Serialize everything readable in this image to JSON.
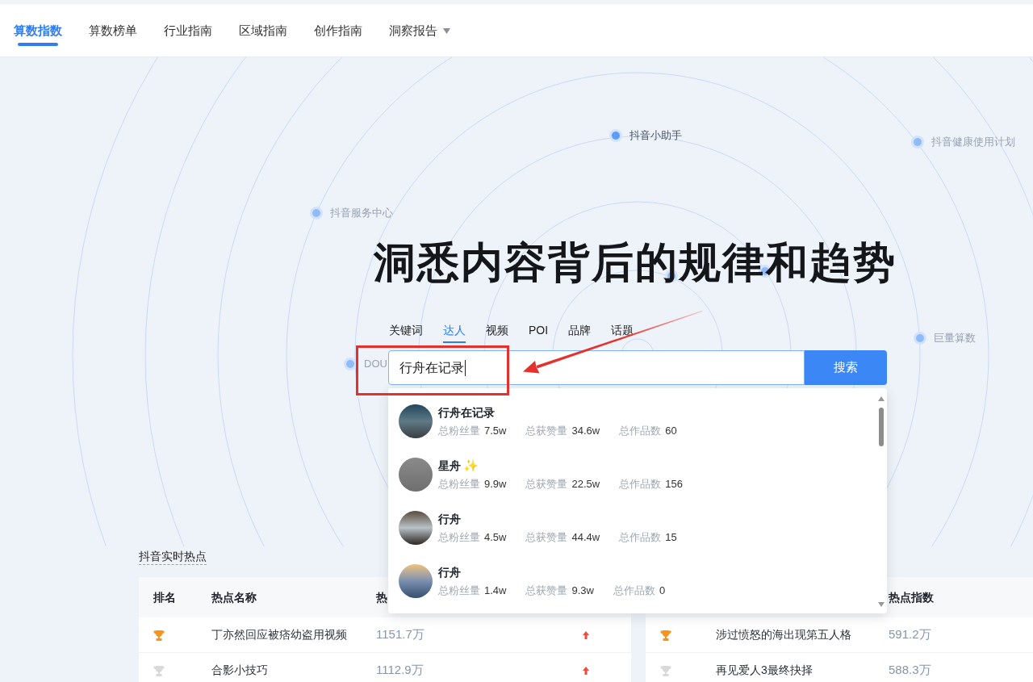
{
  "nav": {
    "items": [
      {
        "label": "算数指数",
        "selected": true,
        "kind": "link"
      },
      {
        "label": "算数榜单",
        "selected": false,
        "kind": "link"
      },
      {
        "label": "行业指南",
        "selected": false,
        "kind": "link"
      },
      {
        "label": "区域指南",
        "selected": false,
        "kind": "link"
      },
      {
        "label": "创作指南",
        "selected": false,
        "kind": "link"
      },
      {
        "label": "洞察报告",
        "selected": false,
        "kind": "dropdown"
      }
    ]
  },
  "hero": {
    "title": "洞悉内容背后的规律和趋势",
    "nodes": [
      {
        "label": "抖音小助手",
        "active": true
      },
      {
        "label": "抖音健康使用计划",
        "active": false
      },
      {
        "label": "抖音服务中心",
        "active": false
      },
      {
        "label": "巨量算数",
        "active": false
      },
      {
        "label": "DOU",
        "active": false
      },
      {
        "active": false
      },
      {
        "active": false
      }
    ]
  },
  "search": {
    "tabs": [
      {
        "label": "关键词",
        "selected": false
      },
      {
        "label": "达人",
        "selected": true
      },
      {
        "label": "视频",
        "selected": false
      },
      {
        "label": "POI",
        "selected": false
      },
      {
        "label": "品牌",
        "selected": false
      },
      {
        "label": "话题",
        "selected": false
      }
    ],
    "value": "行舟在记录",
    "focused": true,
    "button": "搜索"
  },
  "suggestions": [
    {
      "name": "行舟在记录",
      "stats": [
        {
          "label": "总粉丝量",
          "value": "7.5w"
        },
        {
          "label": "总获赞量",
          "value": "34.6w"
        },
        {
          "label": "总作品数",
          "value": "60"
        }
      ]
    },
    {
      "name": "星舟",
      "emoji": "✨",
      "stats": [
        {
          "label": "总粉丝量",
          "value": "9.9w"
        },
        {
          "label": "总获赞量",
          "value": "22.5w"
        },
        {
          "label": "总作品数",
          "value": "156"
        }
      ]
    },
    {
      "name": "行舟",
      "stats": [
        {
          "label": "总粉丝量",
          "value": "4.5w"
        },
        {
          "label": "总获赞量",
          "value": "44.4w"
        },
        {
          "label": "总作品数",
          "value": "15"
        }
      ]
    },
    {
      "name": "行舟",
      "stats": [
        {
          "label": "总粉丝量",
          "value": "1.4w"
        },
        {
          "label": "总获赞量",
          "value": "9.3w"
        },
        {
          "label": "总作品数",
          "value": "0"
        }
      ]
    }
  ],
  "hot": {
    "title": "抖音实时热点",
    "tables": [
      {
        "header": {
          "rank": "排名",
          "name": "热点名称",
          "index": "热"
        },
        "rows": [
          {
            "color": "#f7941d",
            "name": "丁亦然回应被痞幼盗用视频",
            "index": "1151.7万",
            "rising": true
          },
          {
            "color": "#d9d9d9",
            "name": "合影小技巧",
            "index": "1112.9万",
            "rising": true
          }
        ]
      },
      {
        "header": {
          "index": "热点指数"
        },
        "rows": [
          {
            "color": "#f7941d",
            "name": "涉过愤怒的海出现第五人格",
            "index": "591.2万"
          },
          {
            "color": "#d9d9d9",
            "name": "再见爱人3最终抉择",
            "index": "588.3万"
          }
        ]
      }
    ]
  }
}
